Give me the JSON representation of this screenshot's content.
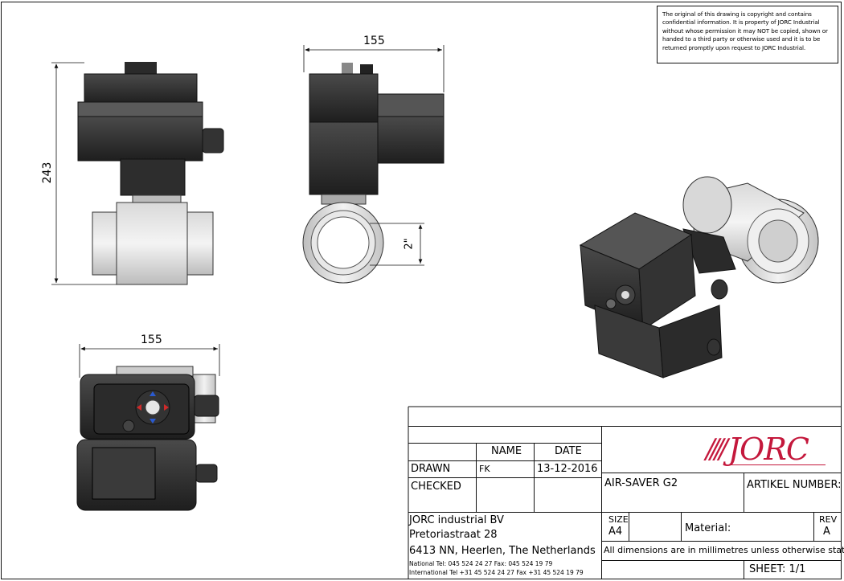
{
  "notice": {
    "line1": "The original of this drawing is copyright and contains",
    "line2": "confidential information. It is property of JORC Industrial",
    "line3": "without whose permission it may NOT be copied, shown or",
    "line4": "handed to a third party or otherwise used and it is to be",
    "line5": "returned promptly upon request to JORC Industrial."
  },
  "dimensions": {
    "height_front": "243",
    "width_side": "155",
    "width_top": "155",
    "pipe_size": "2\""
  },
  "title_block": {
    "col_name": "NAME",
    "col_date": "DATE",
    "row_drawn": "DRAWN",
    "drawn_name": "FK",
    "drawn_date": "13-12-2016",
    "row_checked": "CHECKED",
    "product": "AIR-SAVER G2",
    "artikel_label": "ARTIKEL NUMBER:",
    "company": "JORC industrial BV",
    "street": "Pretoriastraat 28",
    "city": "6413 NN, Heerlen, The Netherlands",
    "national": "National Tel: 045 524 24 27    Fax: 045 524 19 79",
    "international": "International Tel +31 45 524 24 27 Fax +31 45 524 19 79",
    "size_label": "SIZE",
    "size_value": "A4",
    "material_label": "Material:",
    "rev_label": "REV",
    "rev_value": "A",
    "units_note": "All dimensions are in millimetres unless otherwise stated",
    "sheet": "SHEET: 1/1",
    "logo_text": "JORC"
  }
}
